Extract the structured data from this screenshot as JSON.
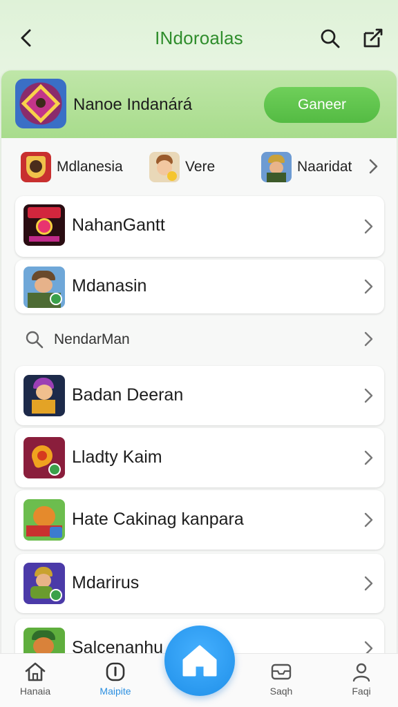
{
  "header": {
    "title": "INdoroalas"
  },
  "banner": {
    "title": "Nanoe Indanárá",
    "button_label": "Ganeer"
  },
  "chips": [
    {
      "label": "Mdlanesia"
    },
    {
      "label": "Vere"
    },
    {
      "label": "Naaridat"
    }
  ],
  "list": {
    "row1": "NahanGantt",
    "row2": "Mdanasin",
    "search_row": "NendarMan",
    "row3": "Badan Deeran",
    "row4": "Lladty Kaim",
    "row5": "Hate Cakinag kanpara",
    "row6": "Mdarirus",
    "row7": "Salcenanhu"
  },
  "bottom_nav": [
    {
      "label": "Hanaia",
      "icon": "home-outline-icon",
      "active": false
    },
    {
      "label": "Maipite",
      "icon": "info-icon",
      "active": true
    },
    {
      "label": "Saqh",
      "icon": "inbox-icon",
      "active": false
    },
    {
      "label": "Faqi",
      "icon": "profile-icon",
      "active": false
    }
  ],
  "colors": {
    "accent_green": "#5cc24a",
    "title_green": "#2f8d2c",
    "active_blue": "#2b8fe0",
    "fab_blue": "#2f9df0"
  }
}
